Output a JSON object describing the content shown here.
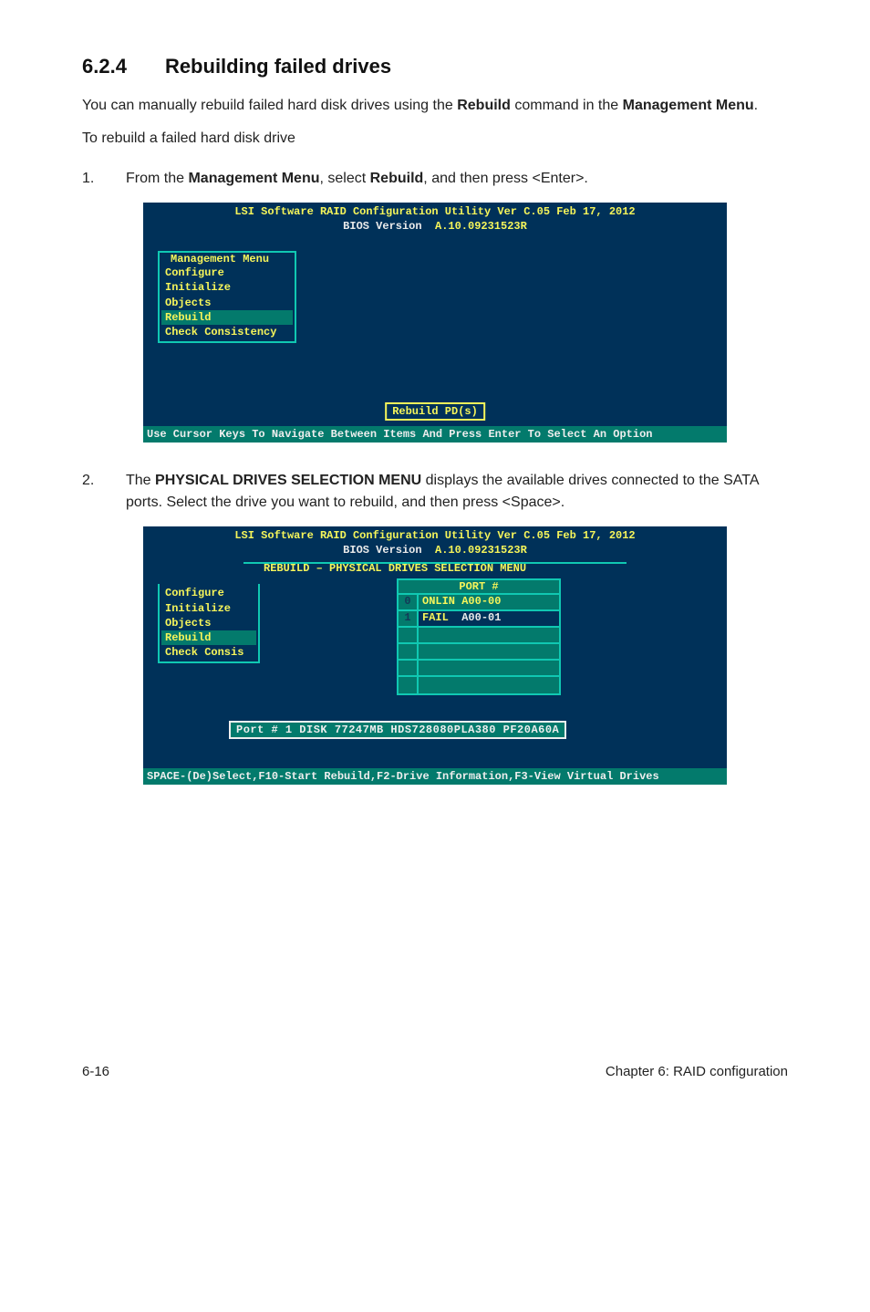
{
  "heading": {
    "number": "6.2.4",
    "title": "Rebuilding failed drives"
  },
  "intro1_pre": "You can manually rebuild failed hard disk drives using the ",
  "intro1_bold1": "Rebuild",
  "intro1_mid": " command in the ",
  "intro1_bold2": "Management Menu",
  "intro1_post": ".",
  "intro2": "To rebuild a failed hard disk drive",
  "step1": {
    "num": "1.",
    "pre": "From the ",
    "b1": "Management Menu",
    "mid": ", select ",
    "b2": "Rebuild",
    "post": ", and then press <Enter>."
  },
  "bios": {
    "util_line": "LSI Software RAID Configuration Utility Ver C.05 Feb 17, 2012",
    "ver_label": "BIOS Version",
    "ver_value": "A.10.09231523R",
    "menu_title": "Management Menu",
    "menu_items": [
      "Configure",
      "Initialize",
      "Objects",
      "Rebuild",
      "Check Consistency"
    ],
    "center_box": "Rebuild PD(s)",
    "footer1": "Use Cursor Keys To Navigate Between Items And Press Enter To Select An Option"
  },
  "step2": {
    "num": "2.",
    "pre": "The ",
    "b1": "PHYSICAL DRIVES SELECTION MENU",
    "post": " displays the available drives connected to the SATA ports. Select the drive you want to rebuild, and then press <Space>."
  },
  "bios2": {
    "panel_title_pre": "REBUILD ",
    "panel_title_dash": "–",
    "panel_title_post": " PHYSICAL DRIVES SELECTION MENU",
    "drive_header": "PORT #",
    "menu_items2": [
      "Configure",
      "Initialize",
      "Objects",
      "Rebuild",
      "Check Consis"
    ],
    "drives": [
      {
        "index": "0",
        "label": "ONLIN",
        "id": "A00-00",
        "fail": false
      },
      {
        "index": "1",
        "label": "FAIL",
        "id": "A00-01",
        "fail": true
      }
    ],
    "status_line": "Port # 1 DISK   77247MB   HDS728080PLA380   PF20A60A",
    "footer2": "SPACE-(De)Select,F10-Start Rebuild,F2-Drive Information,F3-View Virtual Drives"
  },
  "footer": {
    "left": "6-16",
    "right": "Chapter 6: RAID configuration"
  }
}
